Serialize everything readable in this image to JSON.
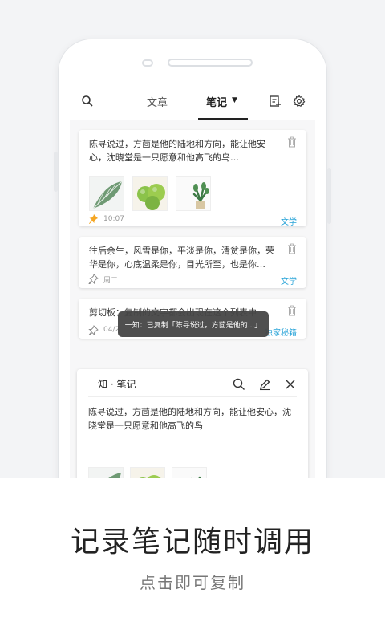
{
  "app": {
    "tabs": [
      {
        "label": "文章"
      },
      {
        "label": "笔记"
      }
    ],
    "active_tab_caret": "▼"
  },
  "notes": [
    {
      "text": "陈寻说过，方茴是他的陆地和方向，能让他安心，沈晓堂是一只愿意和他高飞的鸟…",
      "time": "10:07",
      "category": "文学",
      "pinned": true
    },
    {
      "text": "往后余生，风雪是你，平淡是你，清贫是你，荣华是你，心底温柔是你，目光所至，也是你…",
      "time": "周二",
      "category": "文学",
      "pinned": false
    },
    {
      "text": "剪切板：复制的文字都会出现在这个列表中",
      "time": "04/2",
      "category": "独家秘籍",
      "pinned": false
    }
  ],
  "toast": "一知：已复制「陈寻说过，方茴是他的...」",
  "panel": {
    "title": "一知 · 笔记",
    "text": "陈寻说过，方茴是他的陆地和方向，能让他安心，沈晓堂是一只愿意和他高飞的鸟"
  },
  "footer": {
    "headline": "记录笔记随时调用",
    "subtitle": "点击即可复制"
  },
  "colors": {
    "accent": "#2aa4d8",
    "pin": "#f5a623",
    "toast_bg": "#464646"
  }
}
